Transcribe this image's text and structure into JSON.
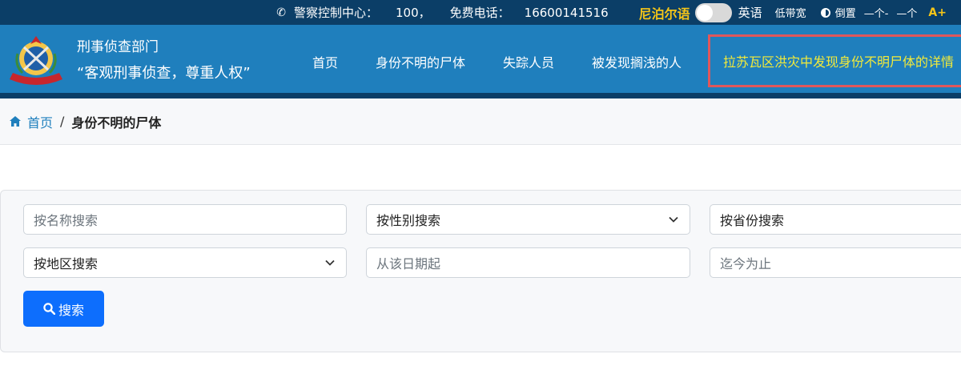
{
  "topbar": {
    "control_center_label": "警察控制中心：",
    "control_center_number": "100，",
    "free_phone_label": "免费电话：",
    "free_phone_number": "16600141516",
    "lang_nepali": "尼泊尔语",
    "lang_english": "英语",
    "low_bandwidth": "低带宽",
    "invert": "倒置",
    "font_decrease": "—个-",
    "font_normal": "—个",
    "font_increase": "A+"
  },
  "header": {
    "dept_name": "刑事侦查部门",
    "motto": "“客观刑事侦查，尊重人权”"
  },
  "nav": {
    "items": [
      "首页",
      "身份不明的尸体",
      "失踪人员",
      "被发现搁浅的人"
    ],
    "highlight": "拉苏瓦区洪灾中发现身份不明尸体的详情"
  },
  "breadcrumb": {
    "home": "首页",
    "separator": "/",
    "current": "身份不明的尸体"
  },
  "search": {
    "name_placeholder": "按名称搜索",
    "gender_select": "按性别搜索",
    "province_select": "按省份搜索",
    "district_select": "按地区搜索",
    "from_date_placeholder": "从该日期起",
    "to_date_placeholder": "迄今为止",
    "button_label": "搜索"
  },
  "colors": {
    "topbar_bg": "#0b3e67",
    "header_bg": "#1f7fbd",
    "highlight_text": "#f2ea3a",
    "highlight_border": "#e0575b",
    "button_bg": "#0d6efd"
  }
}
